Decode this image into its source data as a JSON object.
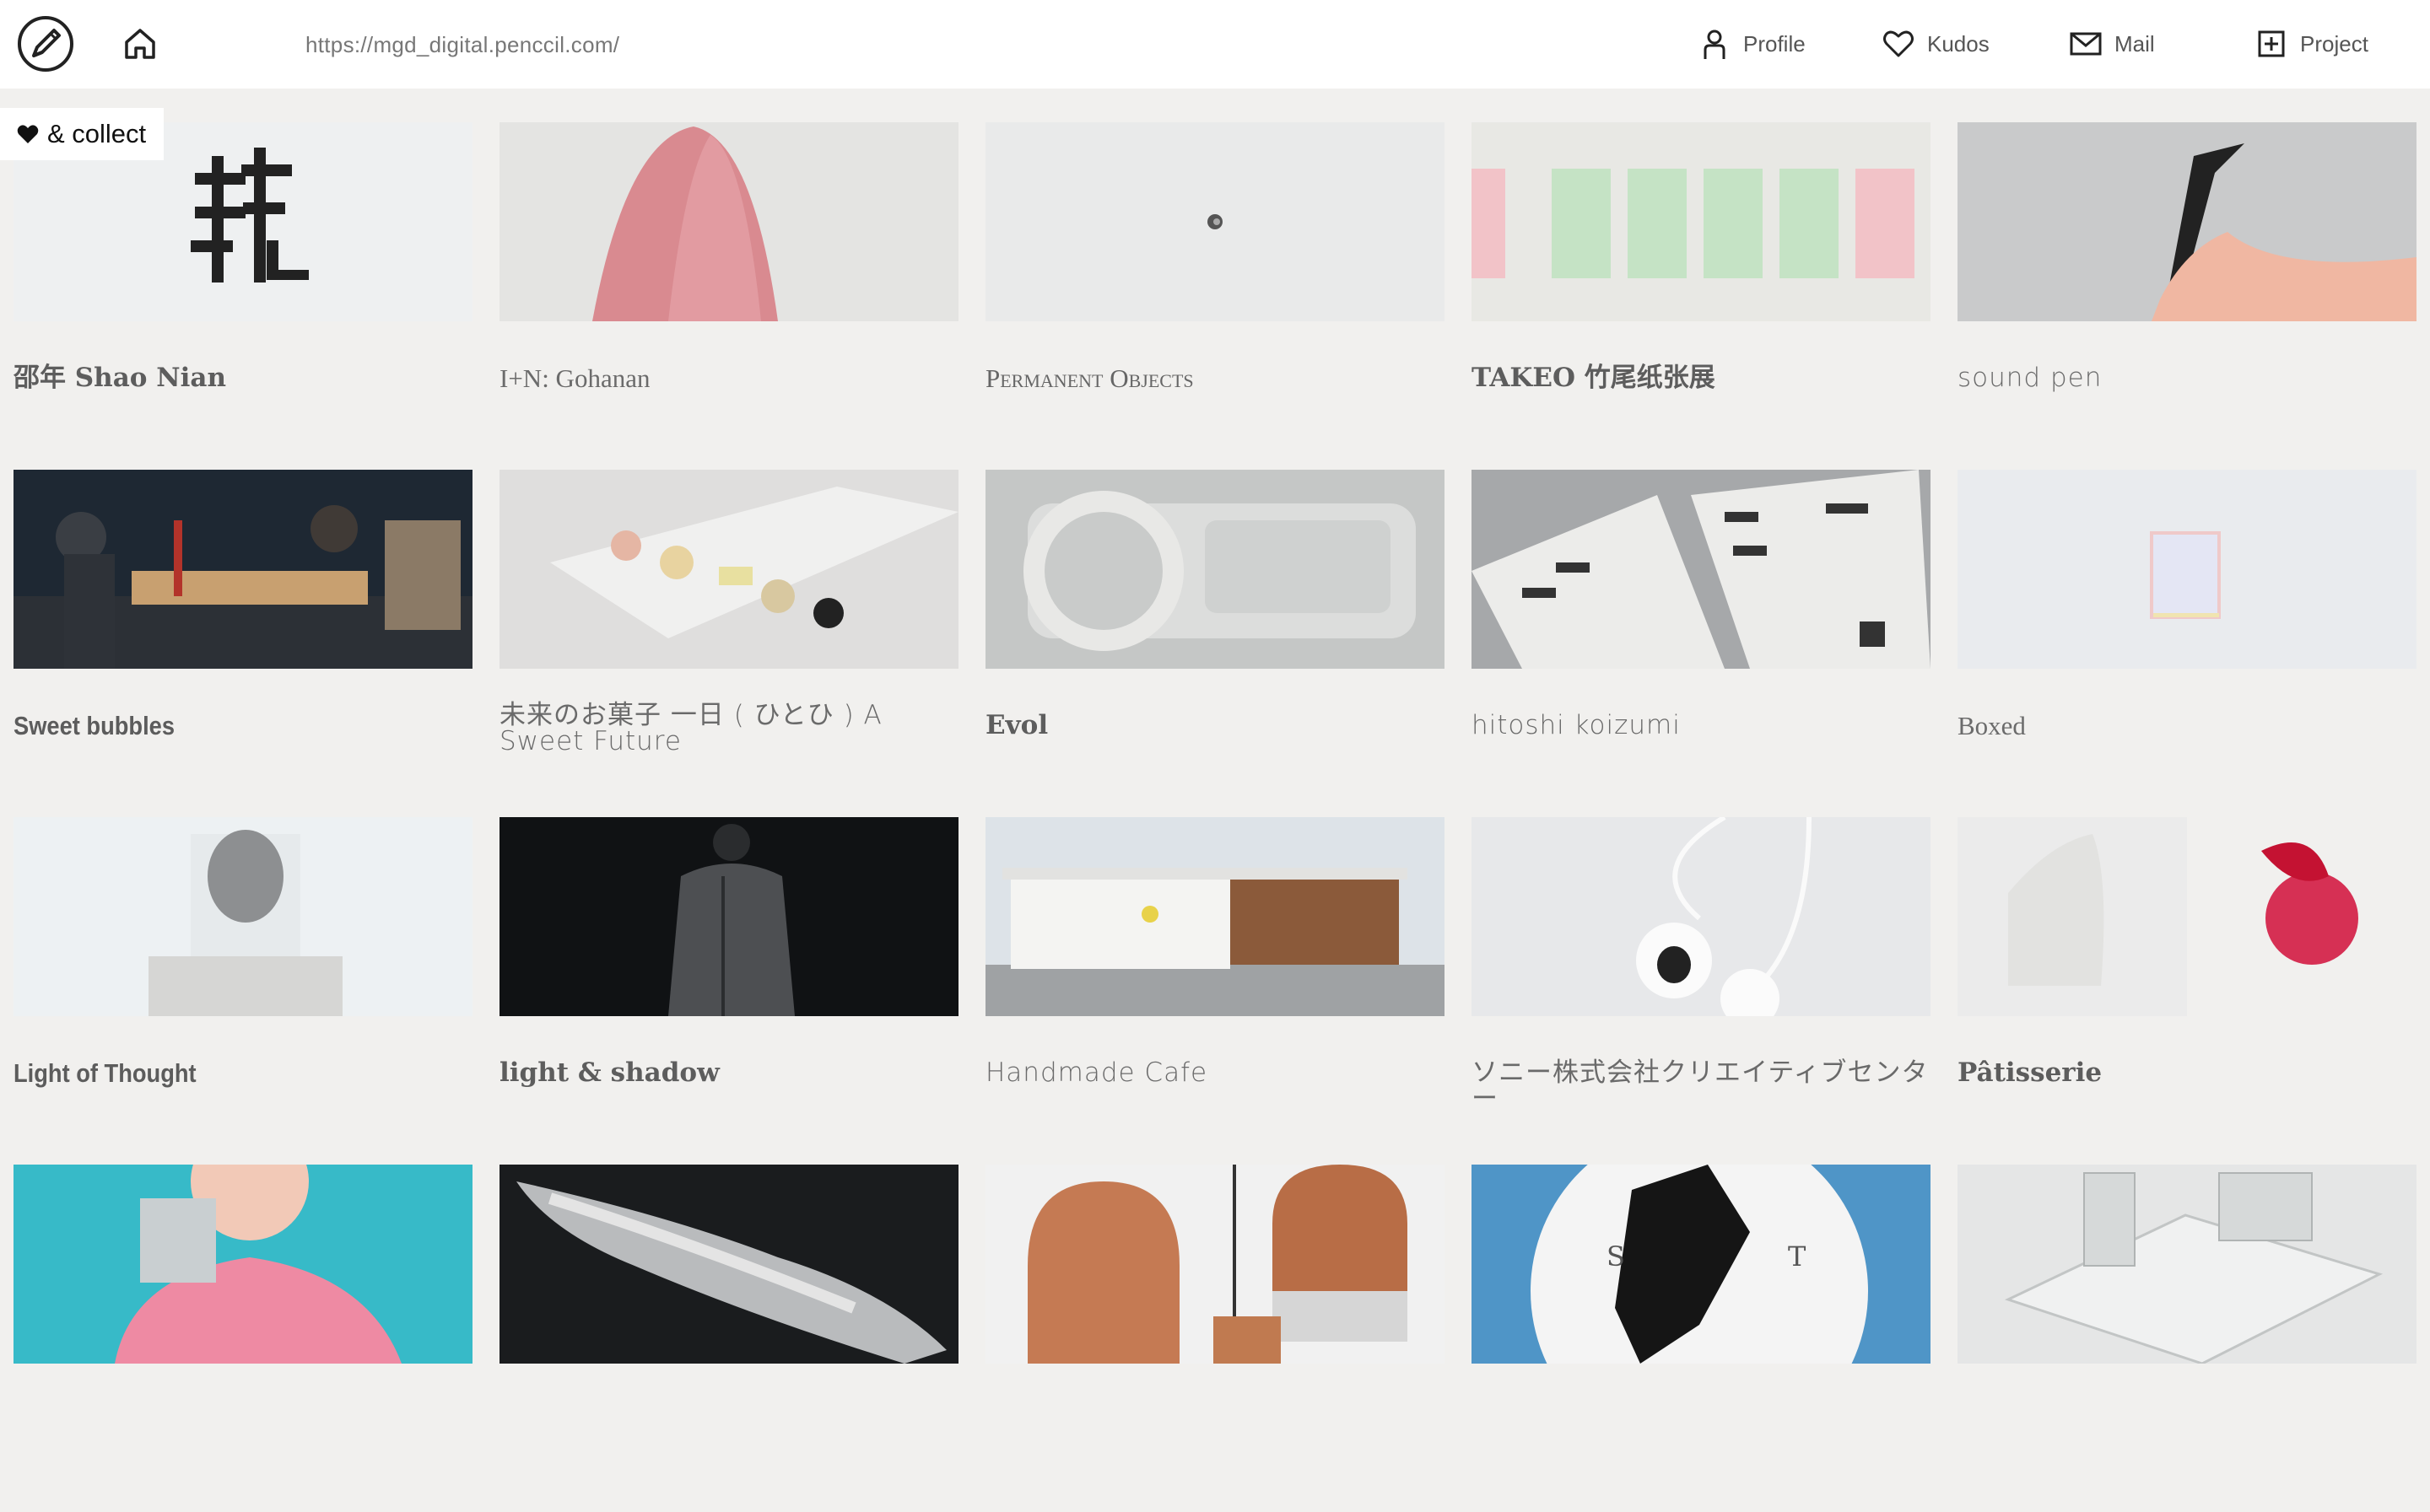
{
  "header": {
    "url": "https://mgd_digital.penccil.com/",
    "nav": {
      "profile": "Profile",
      "kudos": "Kudos",
      "mail": "Mail",
      "project": "Project"
    }
  },
  "collect": {
    "label": "& collect"
  },
  "projects": [
    {
      "title": "邵年 Shao Nian"
    },
    {
      "title": "I+N: Gohanan"
    },
    {
      "title": "Permanent Objects"
    },
    {
      "title": "TAKEO 竹尾纸张展"
    },
    {
      "title": "sound pen"
    },
    {
      "title": "Sweet bubbles"
    },
    {
      "title": "未来のお菓子 一日 ( ひとひ ) A Sweet Future"
    },
    {
      "title": "Evol"
    },
    {
      "title": "hitoshi koizumi"
    },
    {
      "title": "Boxed"
    },
    {
      "title": "Light of Thought"
    },
    {
      "title": "light & shadow"
    },
    {
      "title": "Handmade Cafe"
    },
    {
      "title": "ソニー株式会社クリエイティブセンター"
    },
    {
      "title": "Pâtisserie"
    },
    {
      "title": ""
    },
    {
      "title": ""
    },
    {
      "title": ""
    },
    {
      "title": ""
    },
    {
      "title": ""
    }
  ]
}
